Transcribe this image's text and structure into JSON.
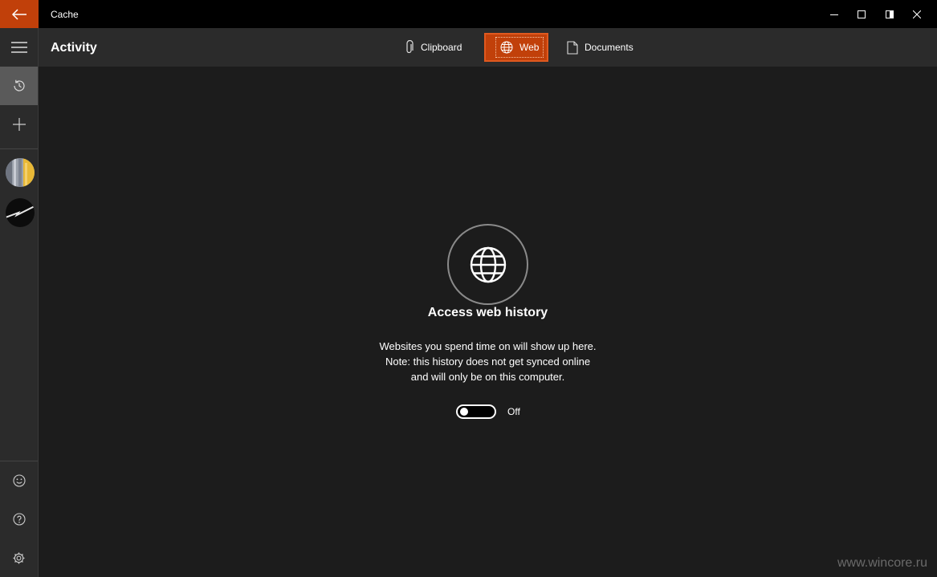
{
  "window": {
    "title": "Cache",
    "controls": [
      "minimize-icon",
      "maximize-icon",
      "restore-icon",
      "close-icon"
    ]
  },
  "sidebar": {
    "items": [
      {
        "name": "menu",
        "icon": "hamburger-icon"
      },
      {
        "name": "history",
        "icon": "history-icon",
        "active": true
      },
      {
        "name": "add",
        "icon": "plus-icon"
      }
    ],
    "bottom_items": [
      {
        "name": "feedback",
        "icon": "smiley-icon"
      },
      {
        "name": "help",
        "icon": "help-icon"
      },
      {
        "name": "settings",
        "icon": "gear-icon"
      }
    ]
  },
  "header": {
    "title": "Activity",
    "tabs": [
      {
        "label": "Clipboard",
        "icon": "paperclip-icon",
        "active": false
      },
      {
        "label": "Web",
        "icon": "globe-icon",
        "active": true
      },
      {
        "label": "Documents",
        "icon": "document-icon",
        "active": false
      }
    ]
  },
  "main": {
    "title": "Access web history",
    "description": [
      "Websites you spend time on will show up here.",
      "Note: this history does not get synced online",
      "and will only be on this computer."
    ],
    "toggle": {
      "state": "Off",
      "on": false
    }
  },
  "watermark": "www.wincore.ru",
  "colors": {
    "accent": "#c1400a",
    "background": "#1c1c1c",
    "chrome": "#2b2b2b",
    "titlebar": "#000000"
  }
}
